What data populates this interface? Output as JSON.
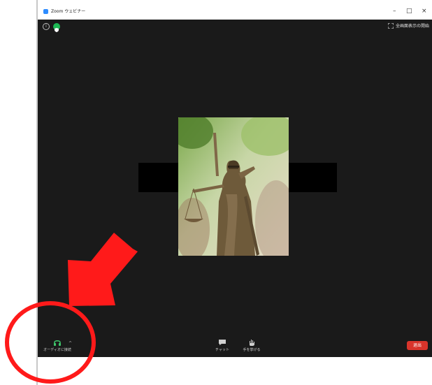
{
  "window": {
    "title": "Zoom ウェビナー",
    "minimize": "–",
    "maximize": "□",
    "close": "×"
  },
  "top_bar": {
    "info_icon": "info-icon",
    "shield_icon": "shield-icon",
    "fullscreen_label": "全画面表示の開始"
  },
  "toolbar": {
    "audio_label": "オーディオに接続",
    "chat_label": "チャット",
    "raise_hand_label": "手を挙げる",
    "leave_label": "退出"
  },
  "colors": {
    "accent": "#2d8cff",
    "stage": "#1a1a1a",
    "leave": "#d9342b",
    "annotation": "#ff1a1a"
  }
}
